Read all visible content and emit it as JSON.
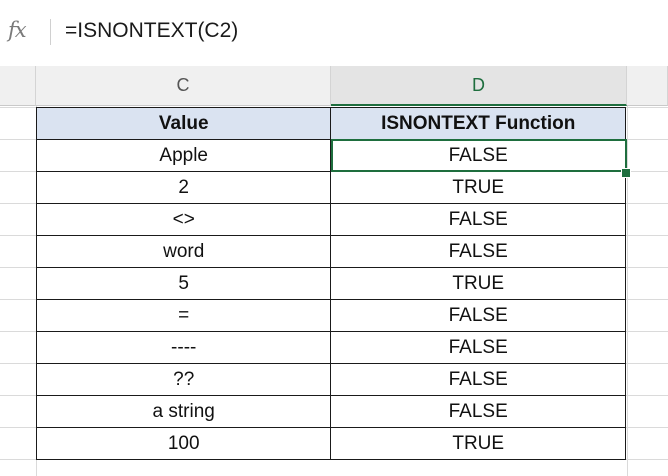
{
  "formula_bar": {
    "fx_label": "fx",
    "formula": "=ISNONTEXT(C2)"
  },
  "columns": [
    {
      "label": "C",
      "active": false
    },
    {
      "label": "D",
      "active": true
    }
  ],
  "table": {
    "headers": [
      "Value",
      "ISNONTEXT Function"
    ],
    "rows": [
      [
        "Apple",
        "FALSE"
      ],
      [
        "2",
        "TRUE"
      ],
      [
        "<>",
        "FALSE"
      ],
      [
        "word",
        "FALSE"
      ],
      [
        "5",
        "TRUE"
      ],
      [
        "=",
        "FALSE"
      ],
      [
        "----",
        "FALSE"
      ],
      [
        "??",
        "FALSE"
      ],
      [
        "a string",
        "FALSE"
      ],
      [
        "100",
        "TRUE"
      ]
    ]
  },
  "selected_cell": "D2",
  "colors": {
    "accent": "#1e6e3e",
    "header_fill": "#dae3f1"
  }
}
